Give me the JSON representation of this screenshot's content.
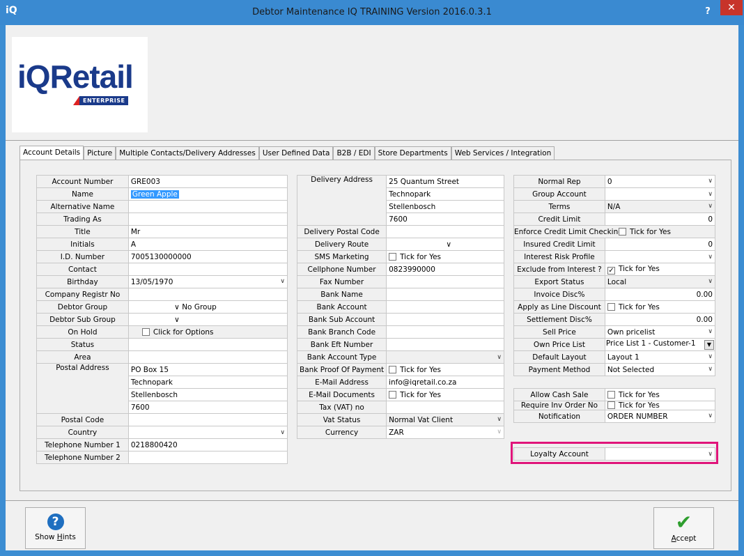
{
  "window": {
    "app_icon": "iQ",
    "title": "Debtor Maintenance IQ TRAINING Version 2016.0.3.1",
    "help": "?",
    "close": "✕"
  },
  "logo": {
    "i": "i",
    "q": "Q",
    "retail": "Retail",
    "enterprise": "ENTERPRISE"
  },
  "tabs": [
    "Account Details",
    "Picture",
    "Multiple Contacts/Delivery Addresses",
    "User Defined Data",
    "B2B / EDI",
    "Store Departments",
    "Web Services / Integration"
  ],
  "colors": {
    "accent": "#3a8ad1",
    "highlight": "#e0157a",
    "selection": "#3399ff",
    "close": "#c7342a"
  },
  "icons": {
    "dropdown": "chevron-down-icon",
    "hints": "help-icon",
    "accept": "checkmark-icon"
  },
  "left": {
    "account_number_label": "Account Number",
    "account_number": "GRE003",
    "name_label": "Name",
    "name": "Green Apple",
    "alt_name_label": "Alternative Name",
    "alt_name": "",
    "trading_as_label": "Trading As",
    "trading_as": "",
    "title_label": "Title",
    "title": "Mr",
    "initials_label": "Initials",
    "initials": "A",
    "id_label": "I.D. Number",
    "id": "7005130000000",
    "contact_label": "Contact",
    "contact": "",
    "birthday_label": "Birthday",
    "birthday": "13/05/1970",
    "company_reg_label": "Company Registr No",
    "company_reg": "",
    "debtor_group_label": "Debtor Group",
    "debtor_group": "No Group",
    "debtor_sub_group_label": "Debtor Sub Group",
    "on_hold_label": "On Hold",
    "on_hold": "Click for Options",
    "status_label": "Status",
    "area_label": "Area",
    "postal_address_label": "Postal Address",
    "postal_address": [
      "PO Box 15",
      "Technopark",
      "Stellenbosch",
      "7600"
    ],
    "postal_code_label": "Postal Code",
    "country_label": "Country",
    "tel1_label": "Telephone Number 1",
    "tel1": "0218800420",
    "tel2_label": "Telephone Number 2",
    "tel2": ""
  },
  "middle": {
    "delivery_address_label": "Delivery Address",
    "delivery_address": [
      "25 Quantum Street",
      "Technopark",
      "Stellenbosch",
      "7600"
    ],
    "delivery_postal_code_label": "Delivery Postal Code",
    "delivery_route_label": "Delivery Route",
    "sms_label": "SMS Marketing",
    "sms": "Tick for Yes",
    "cellphone_label": "Cellphone Number",
    "cellphone": "0823990000",
    "fax_label": "Fax Number",
    "bank_name_label": "Bank Name",
    "bank_account_label": "Bank Account",
    "bank_sub_account_label": "Bank Sub Account",
    "bank_branch_label": "Bank Branch Code",
    "bank_eft_label": "Bank Eft Number",
    "bank_account_type_label": "Bank Account Type",
    "bank_proof_label": "Bank Proof Of Payment",
    "bank_proof": "Tick for Yes",
    "email_label": "E-Mail Address",
    "email": "info@iqretail.co.za",
    "email_docs_label": "E-Mail Documents",
    "email_docs": "Tick for Yes",
    "tax_label": "Tax (VAT) no",
    "vat_status_label": "Vat Status",
    "vat_status": "Normal Vat Client",
    "currency_label": "Currency",
    "currency": "ZAR"
  },
  "right": {
    "normal_rep_label": "Normal Rep",
    "normal_rep": "0",
    "group_account_label": "Group Account",
    "terms_label": "Terms",
    "terms": "N/A",
    "credit_limit_label": "Credit Limit",
    "credit_limit": "0",
    "enforce_label": "Enforce Credit Limit Checking",
    "enforce": "Tick for Yes",
    "insured_label": "Insured Credit Limit",
    "insured": "0",
    "interest_risk_label": "Interest Risk Profile",
    "exclude_interest_label": "Exclude from Interest ?",
    "exclude_interest": "Tick for Yes",
    "export_status_label": "Export Status",
    "export_status": "Local",
    "invoice_disc_label": "Invoice Disc%",
    "invoice_disc": "0.00",
    "apply_line_label": "Apply as Line Discount",
    "apply_line": "Tick for Yes",
    "settlement_label": "Settlement Disc%",
    "settlement": "0.00",
    "sell_price_label": "Sell Price",
    "sell_price": "Own pricelist",
    "own_price_list_label": "Own Price List",
    "own_price_list": "Price List 1 - Customer-1",
    "default_layout_label": "Default Layout",
    "default_layout": "Layout 1",
    "payment_method_label": "Payment Method",
    "payment_method": "Not Selected",
    "allow_cash_label": "Allow Cash Sale",
    "allow_cash": "Tick for Yes",
    "require_inv_label": "Require Inv Order No",
    "require_inv": "Tick for Yes",
    "notification_label": "Notification",
    "notification": "ORDER NUMBER",
    "loyalty_label": "Loyalty Account"
  },
  "buttons": {
    "hints_pre": "Show ",
    "hints_u": "H",
    "hints_post": "ints",
    "accept_u": "A",
    "accept_post": "ccept"
  }
}
